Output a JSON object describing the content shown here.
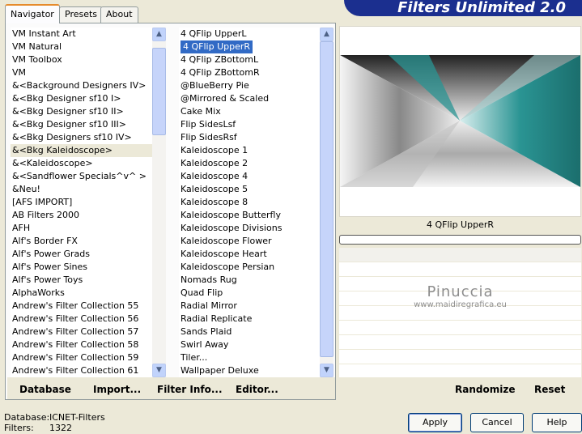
{
  "tabs": [
    {
      "label": "Navigator",
      "active": true
    },
    {
      "label": "Presets",
      "active": false
    },
    {
      "label": "About",
      "active": false
    }
  ],
  "app_title": "Filters Unlimited 2.0",
  "categories": [
    "VM Instant Art",
    "VM Natural",
    "VM Toolbox",
    "VM",
    "&<Background Designers IV>",
    "&<Bkg Designer sf10 I>",
    "&<Bkg Designer sf10 II>",
    "&<Bkg Designer sf10 III>",
    "&<Bkg Designers sf10 IV>",
    "&<Bkg Kaleidoscope>",
    "&<Kaleidoscope>",
    "&<Sandflower Specials^v^ >",
    "&Neu!",
    "[AFS IMPORT]",
    "AB Filters 2000",
    "AFH",
    "Alf's Border FX",
    "Alf's Power Grads",
    "Alf's Power Sines",
    "Alf's Power Toys",
    "AlphaWorks",
    "Andrew's Filter Collection 55",
    "Andrew's Filter Collection 56",
    "Andrew's Filter Collection 57",
    "Andrew's Filter Collection 58",
    "Andrew's Filter Collection 59",
    "Andrew's Filter Collection 61"
  ],
  "selected_category": "&<Bkg Kaleidoscope>",
  "filters": [
    "4 QFlip UpperL",
    "4 QFlip UpperR",
    "4 QFlip ZBottomL",
    "4 QFlip ZBottomR",
    "@BlueBerry Pie",
    "@Mirrored & Scaled",
    "Cake Mix",
    "Flip SidesLsf",
    "Flip SidesRsf",
    "Kaleidoscope 1",
    "Kaleidoscope 2",
    "Kaleidoscope 4",
    "Kaleidoscope 5",
    "Kaleidoscope 8",
    "Kaleidoscope Butterfly",
    "Kaleidoscope Divisions",
    "Kaleidoscope Flower",
    "Kaleidoscope Heart",
    "Kaleidoscope Persian",
    "Nomads Rug",
    "Quad Flip",
    "Radial Mirror",
    "Radial Replicate",
    "Sands Plaid",
    "Swirl Away",
    "Tiler...",
    "Wallpaper Deluxe"
  ],
  "selected_filter": "4 QFlip UpperR",
  "left_buttons": {
    "database": "Database",
    "import": "Import...",
    "filter_info": "Filter Info...",
    "editor": "Editor..."
  },
  "right_buttons": {
    "randomize": "Randomize",
    "reset": "Reset"
  },
  "preview_caption": "4 QFlip UpperR",
  "watermark": {
    "name": "Pinuccia",
    "site": "www.maidiregrafica.eu"
  },
  "status": {
    "database_label": "Database:",
    "database_value": "ICNET-Filters",
    "filters_label": "Filters:",
    "filters_value": "1322"
  },
  "dialog_buttons": {
    "apply": "Apply",
    "cancel": "Cancel",
    "help": "Help"
  },
  "colors": {
    "banner": "#1b2f8f",
    "selection": "#316ac5",
    "teal": "#2a9493"
  },
  "icons": {
    "scroll_up": "▲",
    "scroll_down": "▼"
  }
}
